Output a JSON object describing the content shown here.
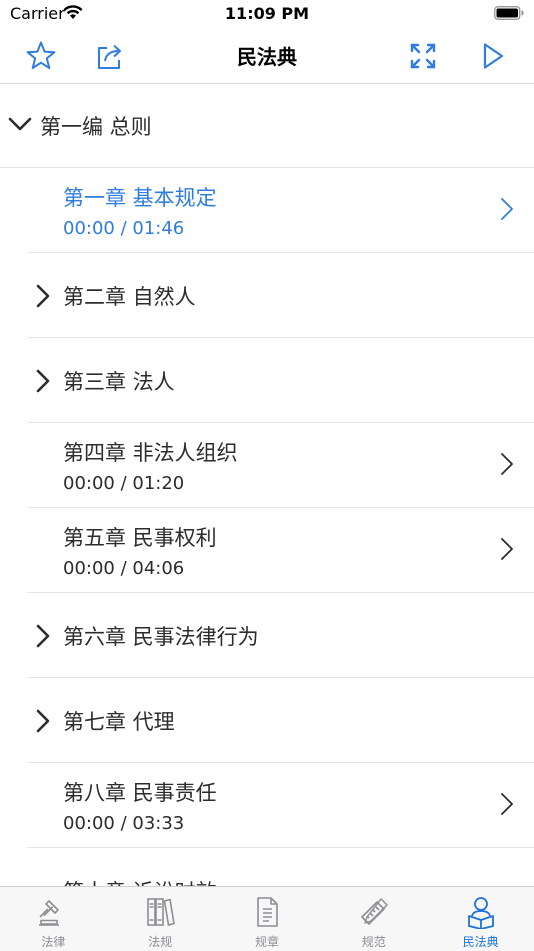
{
  "status": {
    "carrier": "Carrier",
    "time": "11:09 PM"
  },
  "nav": {
    "title": "民法典",
    "icons": [
      "star-icon",
      "share-icon",
      "fullscreen-icon",
      "play-icon"
    ]
  },
  "section": {
    "title": "第一编 总则",
    "expanded": true
  },
  "rows": [
    {
      "title": "第一章 基本规定",
      "time": "00:00 / 01:46",
      "active": true
    },
    {
      "title": "第二章 自然人",
      "time": "",
      "expandable": true
    },
    {
      "title": "第三章 法人",
      "time": "",
      "expandable": true
    },
    {
      "title": "第四章 非法人组织",
      "time": "00:00 / 01:20"
    },
    {
      "title": "第五章 民事权利",
      "time": "00:00 / 04:06"
    },
    {
      "title": "第六章 民事法律行为",
      "time": "",
      "expandable": true
    },
    {
      "title": "第七章 代理",
      "time": "",
      "expandable": true
    },
    {
      "title": "第八章 民事责任",
      "time": "00:00 / 03:33"
    },
    {
      "title": "第十章 诉讼时效",
      "time": ""
    }
  ],
  "tabs": [
    {
      "label": "法律",
      "icon": "gavel-icon"
    },
    {
      "label": "法规",
      "icon": "books-icon"
    },
    {
      "label": "规章",
      "icon": "document-icon"
    },
    {
      "label": "规范",
      "icon": "ruler-pencil-icon"
    },
    {
      "label": "民法典",
      "icon": "reader-icon",
      "selected": true
    }
  ],
  "colors": {
    "accent": "#2f7ddf",
    "tab_selected": "#1c73d8",
    "tab_inactive": "#8e8e93"
  }
}
